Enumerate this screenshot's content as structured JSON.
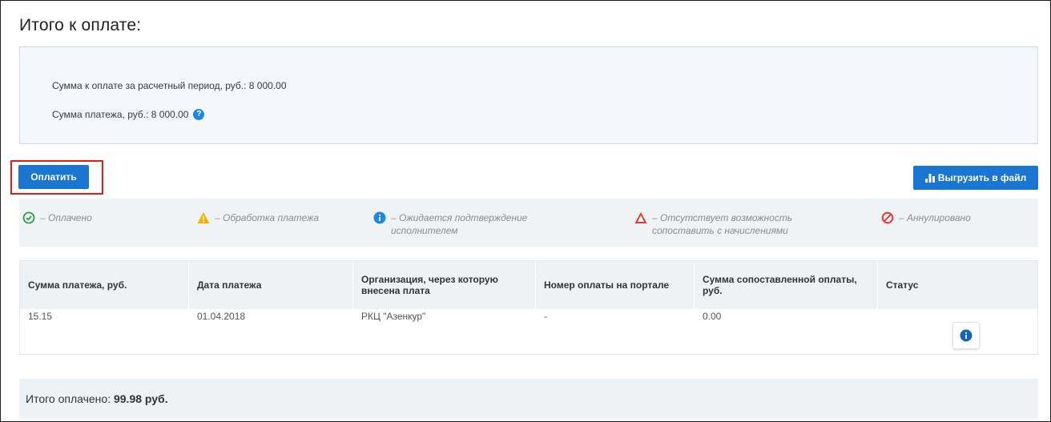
{
  "page": {
    "title": "Итого к оплате:"
  },
  "summary": {
    "period_sum": "Сумма к оплате за расчетный период, руб.: 8 000.00",
    "payment_sum": "Сумма платежа, руб.: 8 000.00"
  },
  "actions": {
    "pay_label": "Оплатить",
    "export_label": "Выгрузить в файл"
  },
  "legend": [
    {
      "icon": "check-circle-icon",
      "color": "#2e9e44",
      "text": "– Оплачено"
    },
    {
      "icon": "warning-icon",
      "color": "#f0b400",
      "text": "– Обработка платежа"
    },
    {
      "icon": "info-icon",
      "color": "#1e88e5",
      "text": "– Ожидается подтверждение исполнителем"
    },
    {
      "icon": "error-triangle-icon",
      "color": "#e53935",
      "text": "– Отсутствует возможность сопоставить с начислениями"
    },
    {
      "icon": "cancel-icon",
      "color": "#e53935",
      "text": "– Аннулировано"
    }
  ],
  "table": {
    "columns": [
      "Сумма платежа, руб.",
      "Дата платежа",
      "Организация, через которую внесена плата",
      "Номер оплаты на портале",
      "Сумма сопоставленной оплаты, руб.",
      "Статус"
    ],
    "rows": [
      {
        "amount": "15.15",
        "date": "01.04.2018",
        "org": "РКЦ \"Азенкур\"",
        "portal_no": "-",
        "matched": "0.00",
        "status_icon": "info-icon"
      }
    ]
  },
  "total": {
    "label": "Итого оплачено:",
    "value": "99.98 руб."
  }
}
